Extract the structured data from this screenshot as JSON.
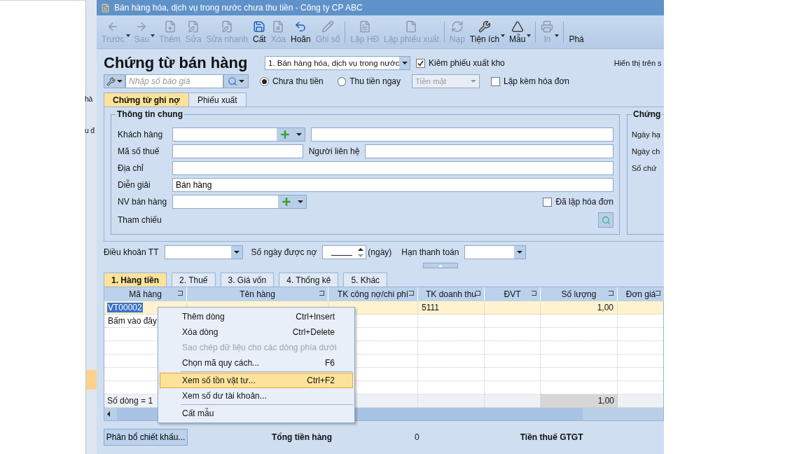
{
  "window": {
    "title": "Bán hàng hóa, dịch vụ trong nước chưa thu tiền - Công ty CP ABC"
  },
  "background_window": {
    "texts": [
      "hà",
      "u đ"
    ]
  },
  "toolbar": [
    {
      "kind": "button",
      "label": "Trước",
      "disabled": true,
      "dropdown": true
    },
    {
      "kind": "button",
      "label": "Sau",
      "disabled": true,
      "dropdown": true
    },
    {
      "kind": "button",
      "label": "Thêm",
      "disabled": true,
      "dropdown": false
    },
    {
      "kind": "button",
      "label": "Sửa",
      "disabled": true,
      "dropdown": false
    },
    {
      "kind": "button",
      "label": "Sửa nhanh",
      "disabled": true,
      "dropdown": false
    },
    {
      "kind": "button",
      "label": "Cất",
      "disabled": false,
      "dropdown": false
    },
    {
      "kind": "button",
      "label": "Xóa",
      "disabled": true,
      "dropdown": false
    },
    {
      "kind": "button",
      "label": "Hoãn",
      "disabled": false,
      "dropdown": false
    },
    {
      "kind": "button",
      "label": "Ghi sổ",
      "disabled": true,
      "dropdown": false
    },
    {
      "kind": "separator"
    },
    {
      "kind": "button",
      "label": "Lập HĐ",
      "disabled": true,
      "dropdown": false
    },
    {
      "kind": "button",
      "label": "Lập phiếu xuất",
      "disabled": true,
      "dropdown": false
    },
    {
      "kind": "separator"
    },
    {
      "kind": "button",
      "label": "Nạp",
      "disabled": true,
      "dropdown": false
    },
    {
      "kind": "button",
      "label": "Tiện ích",
      "disabled": false,
      "dropdown": true
    },
    {
      "kind": "button",
      "label": "Mẫu",
      "disabled": false,
      "dropdown": true
    },
    {
      "kind": "separator"
    },
    {
      "kind": "button",
      "label": "In",
      "disabled": true,
      "dropdown": true
    },
    {
      "kind": "separator"
    },
    {
      "kind": "button",
      "label": "Phá",
      "disabled": false,
      "dropdown": false
    }
  ],
  "header": {
    "title": "Chứng từ bán hàng",
    "type_select": "1. Bán hàng hóa, dịch vụ trong nước",
    "export_check": {
      "label": "Kiêm phiếu xuất kho",
      "checked": true
    },
    "display_label": "Hiển thị trên s",
    "quote_search": {
      "placeholder": "Nhập số báo giá"
    },
    "payment_options": [
      {
        "label": "Chưa thu tiền",
        "selected": true
      },
      {
        "label": "Thu tiền ngay",
        "selected": false
      }
    ],
    "payment_method": {
      "value": "Tiền mặt",
      "disabled": true
    },
    "invoice_check": {
      "label": "Lập kèm hóa đơn",
      "checked": false
    }
  },
  "tabs": [
    {
      "label": "Chứng từ ghi nợ",
      "selected": true
    },
    {
      "label": "Phiếu xuất",
      "selected": false
    }
  ],
  "general_info": {
    "title": "Thông tin chung",
    "fields": [
      {
        "kind": "lookup_name",
        "label": "Khách hàng"
      },
      {
        "kind": "pair",
        "label": "Mã số thuế",
        "second_label": "Người liên hệ"
      },
      {
        "kind": "text",
        "label": "Địa chỉ"
      },
      {
        "kind": "text",
        "label": "Diễn giải",
        "value": "Bán hàng"
      },
      {
        "kind": "lookup_check",
        "label": "NV bán hàng",
        "check": {
          "label": "Đã lập hóa đơn",
          "checked": false
        }
      },
      {
        "kind": "reference",
        "label": "Tham chiếu"
      }
    ]
  },
  "voucher_info": {
    "title": "Chứng",
    "labels": [
      "Ngày hạ",
      "Ngày ch",
      "Số chứ"
    ]
  },
  "terms": {
    "payment_terms_label": "Điều khoản TT",
    "due_days_label": "Số ngày được nợ",
    "due_days_unit": "(ngày)",
    "due_date_label": "Hạn thanh toán"
  },
  "grid_tabs": [
    {
      "label": "1. Hàng tiền",
      "selected": true
    },
    {
      "label": "2. Thuế",
      "selected": false
    },
    {
      "label": "3. Giá vốn",
      "selected": false
    },
    {
      "label": "4. Thống kê",
      "selected": false
    },
    {
      "label": "5. Khác",
      "selected": false
    }
  ],
  "grid": {
    "columns": [
      "Mã hàng",
      "Tên hàng",
      "TK công nợ/chi phí",
      "TK doanh thu",
      "ĐVT",
      "Số lượng",
      "Đơn giá"
    ],
    "rows": [
      {
        "kind": "data",
        "selected": true,
        "cells": [
          "VT00002",
          "",
          "",
          "5111",
          "",
          "1,00",
          ""
        ]
      },
      {
        "kind": "new",
        "selected": false,
        "cells": [
          "Bấm vào đây",
          "",
          "",
          "",
          "",
          "",
          ""
        ]
      }
    ],
    "footer": {
      "row_count": "Số dòng = 1",
      "quantity_total": "1,00"
    }
  },
  "context_menu": [
    {
      "kind": "item",
      "label": "Thêm dòng",
      "shortcut": "Ctrl+Insert",
      "disabled": false,
      "selected": false
    },
    {
      "kind": "item",
      "label": "Xóa dòng",
      "shortcut": "Ctrl+Delete",
      "disabled": false,
      "selected": false
    },
    {
      "kind": "item",
      "label": "Sao chép dữ liệu cho các dòng phía dưới",
      "disabled": true,
      "selected": false
    },
    {
      "kind": "item",
      "label": "Chọn mã quy cách...",
      "shortcut": "F6",
      "disabled": false,
      "selected": false
    },
    {
      "kind": "separator"
    },
    {
      "kind": "item",
      "label": "Xem số tồn vật tư...",
      "shortcut": "Ctrl+F2",
      "disabled": false,
      "selected": true
    },
    {
      "kind": "item",
      "label": "Xem số dư tài khoản...",
      "disabled": false,
      "selected": false
    },
    {
      "kind": "separator"
    },
    {
      "kind": "item",
      "label": "Cất mẫu",
      "disabled": false,
      "selected": false
    }
  ],
  "footer": {
    "button": "Phân bổ chiết khấu...",
    "total_label": "Tổng tiền hàng",
    "total_value": "0",
    "vat_label": "Tiền thuế GTGT"
  }
}
